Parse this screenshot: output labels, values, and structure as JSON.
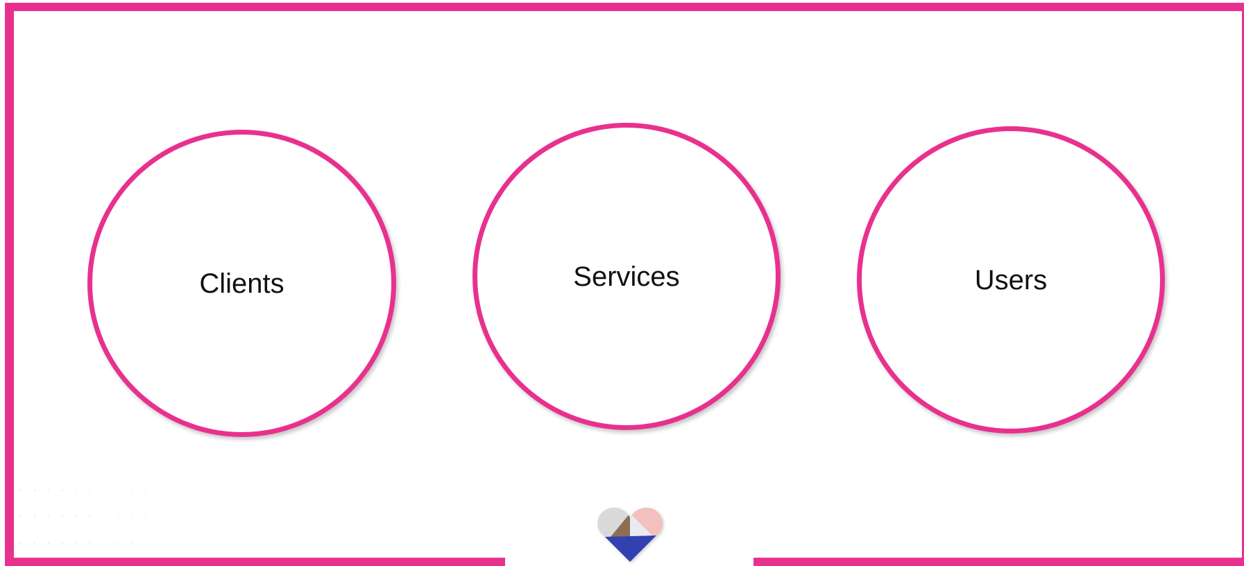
{
  "diagram": {
    "nodes": [
      {
        "id": "clients",
        "label": "Clients"
      },
      {
        "id": "services",
        "label": "Services"
      },
      {
        "id": "users",
        "label": "Users"
      }
    ]
  },
  "colors": {
    "accent": "#e8318f",
    "logo_grey": "#d9d9d9",
    "logo_pink": "#f2c1bd",
    "logo_brown": "#8c6e52",
    "logo_light": "#e9eaf4",
    "logo_blue": "#3340b0"
  },
  "logo": {
    "icon": "heart-logo-icon"
  }
}
